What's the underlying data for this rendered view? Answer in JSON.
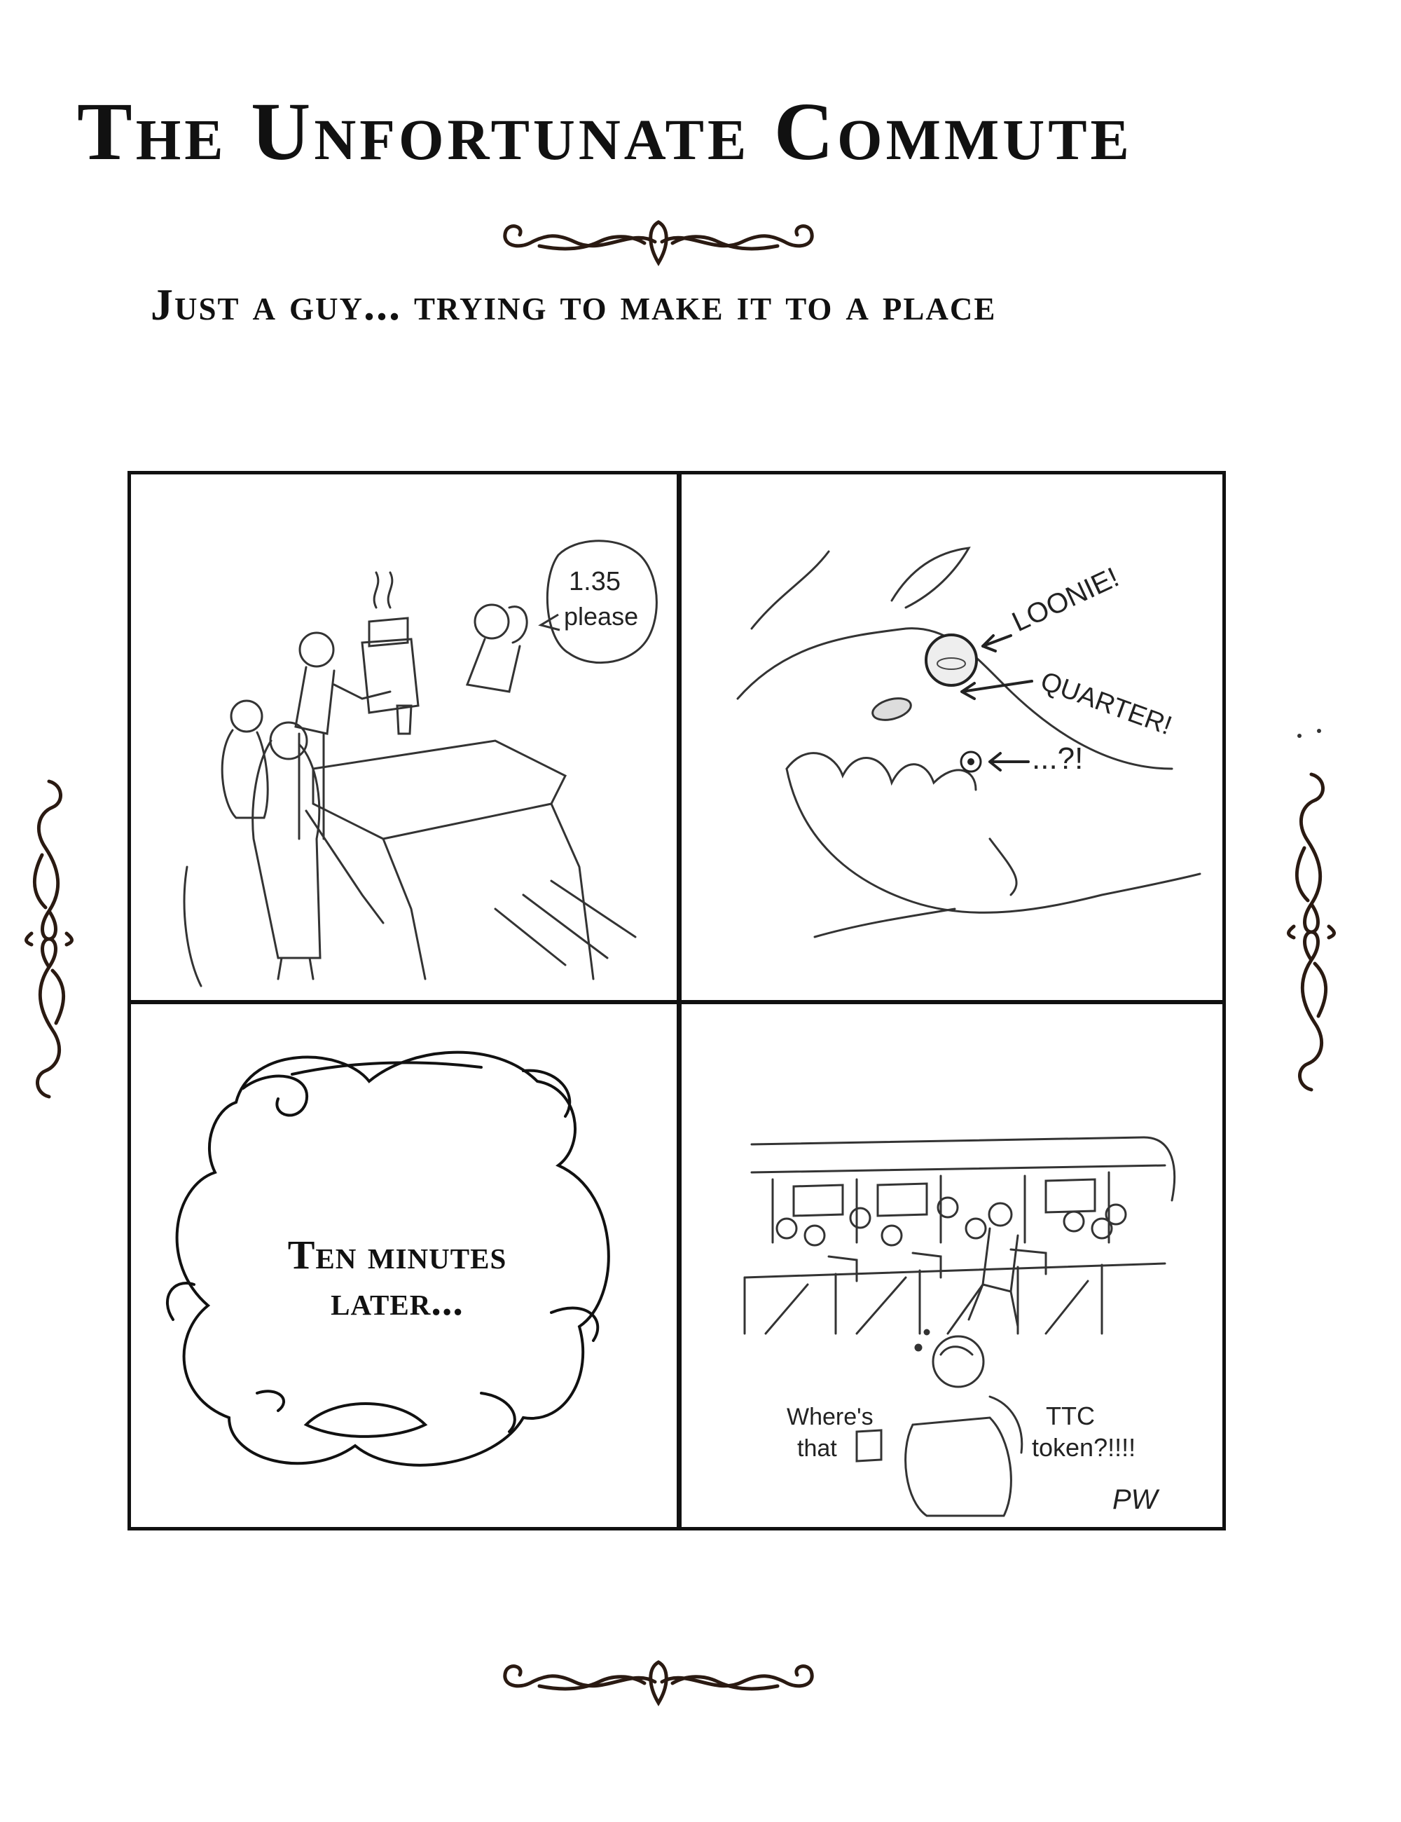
{
  "title": "The Unfortunate Commute",
  "subtitle": "Just a guy... trying to make it to a place",
  "panels": {
    "panel1": {
      "speech": [
        "1.35",
        "please"
      ]
    },
    "panel2": {
      "labels": {
        "loonie": "LOONIE!",
        "quarter": "QUARTER!",
        "mystery": "...?!"
      }
    },
    "panel3": {
      "caption": [
        "Ten minutes",
        "later..."
      ]
    },
    "panel4": {
      "speech_left": [
        "Where's",
        "that"
      ],
      "speech_right": [
        "TTC",
        "token?!!!!"
      ],
      "signature": "PW"
    }
  }
}
